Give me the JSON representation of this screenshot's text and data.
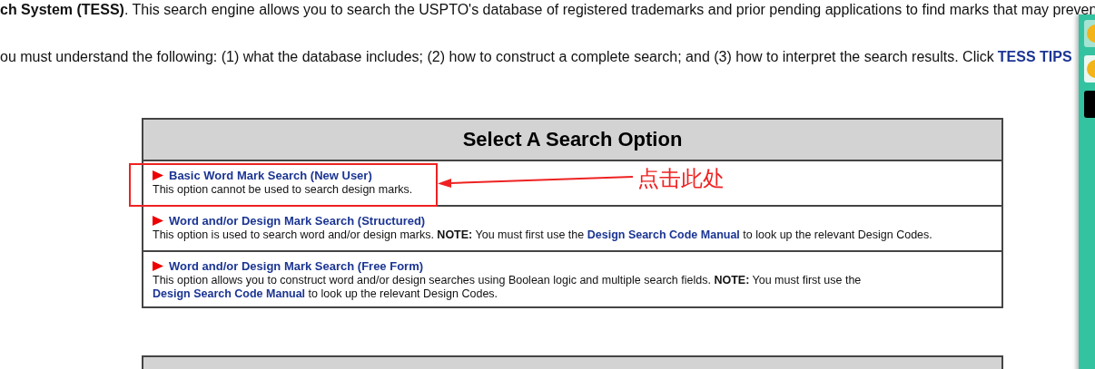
{
  "intro": [
    "**ch System (TESS)**. This search engine allows you to search the USPTO's database of registered trademarks and prior pending applications to find marks that may preven",
    "ou must understand the following: (1) what the database includes; (2) how to construct a complete search; and (3) how to interpret the search results. Click"
  ],
  "intro_link": "TESS TIPS",
  "search_options": {
    "title": "Select A Search Option",
    "options": [
      {
        "label": "Basic Word Mark Search (New User)",
        "description": [
          {
            "kind": "text",
            "text": "This option cannot be used to search design marks."
          }
        ]
      },
      {
        "label": "Word and/or Design Mark Search (Structured)",
        "description": [
          {
            "kind": "text",
            "text": "This option is used to search word and/or design marks. **NOTE:** You must first use the"
          },
          {
            "kind": "link",
            "text": "Design Search Code Manual"
          },
          {
            "kind": "text",
            "text": "to look up the relevant Design Codes."
          }
        ]
      },
      {
        "label": "Word and/or Design Mark Search (Free Form)",
        "description": [
          {
            "kind": "text",
            "text": "This option allows you to construct word and/or design searches using Boolean logic and multiple search fields. **NOTE:** You must first use the"
          },
          {
            "kind": "link",
            "text": "Design Search Code Manual"
          },
          {
            "kind": "text",
            "text": "to look up the relevant Design Codes."
          }
        ]
      }
    ]
  },
  "annotation": {
    "text": "点击此处"
  }
}
